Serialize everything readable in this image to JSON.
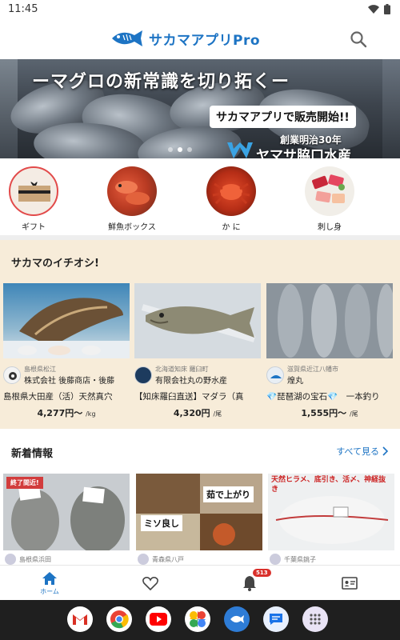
{
  "status_bar": {
    "time": "11:45"
  },
  "header": {
    "app_name": "サカマアプリPro"
  },
  "banner": {
    "headline": "ーマグロの新常識を切り拓くー",
    "cta": "サカマアプリで販売開始!!",
    "sub": "創業明治30年",
    "brand": "ヤマサ脇口水産",
    "slide_count": 3,
    "active_slide": 1
  },
  "categories": [
    {
      "label": "ギフト",
      "icon": "gift-box"
    },
    {
      "label": "鮮魚ボックス",
      "icon": "fish-box"
    },
    {
      "label": "か に",
      "icon": "crab"
    },
    {
      "label": "刺し身",
      "icon": "sashimi"
    }
  ],
  "recommend": {
    "title": "サカマのイチオシ!",
    "items": [
      {
        "location": "島根県松江",
        "seller": "株式会社 後藤商店・後藤",
        "name": "島根県大田産（活）天然真穴",
        "price": "4,277円〜",
        "unit": "/kg"
      },
      {
        "location": "北海道知床 羅臼町",
        "seller": "有限会社丸の野水産",
        "name": "【知床羅臼直送】マダラ（真",
        "price": "4,320円",
        "unit": "/尾"
      },
      {
        "location": "滋賀県近江八幡市",
        "seller": "煌丸",
        "name": "💎琵琶湖の宝石💎　一本釣り",
        "price": "1,555円〜",
        "unit": "/尾"
      }
    ]
  },
  "news": {
    "title": "新着情報",
    "more": "すべて見る",
    "items": [
      {
        "location": "島根県浜田",
        "badge": "終了間近!",
        "overlay": ""
      },
      {
        "location": "青森県八戸",
        "badge": "",
        "overlay": "茹で上がり"
      },
      {
        "location": "千葉県銚子",
        "badge": "",
        "overlay": "天然ヒラメ、底引き、活〆、神経抜き"
      }
    ],
    "extra_overlay": "ミソ良し"
  },
  "bottom_nav": {
    "home_label": "ホーム",
    "notification_count": "513"
  },
  "colors": {
    "brand": "#1d74c4",
    "recommend_bg": "#f7ecd9",
    "badge_red": "#d9302b"
  }
}
